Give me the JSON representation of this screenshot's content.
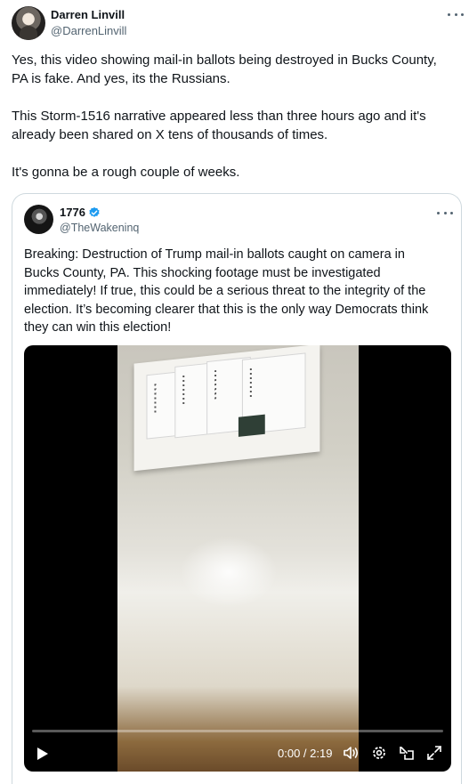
{
  "tweet": {
    "author": {
      "name": "Darren Linvill",
      "handle": "@DarrenLinvill"
    },
    "paragraphs": [
      "Yes, this video showing mail-in ballots being destroyed in Bucks County,\nPA is fake. And yes, its the Russians.",
      "This Storm-1516 narrative appeared less than three hours ago and it's\nalready been shared on X tens of thousands of times.",
      "It's gonna be a rough couple of weeks."
    ]
  },
  "quote": {
    "author": {
      "name": "1776",
      "handle": "@TheWakeninq",
      "verified": true
    },
    "text": "Breaking: Destruction of Trump mail-in ballots caught on camera in\nBucks County, PA. This shocking footage must be investigated\nimmediately! If true, this could be a serious threat to the integrity of the\nelection. It’s becoming clearer that this is the only way Democrats think\nthey can win this election!",
    "video": {
      "time_display": "0:00 / 2:19",
      "progress_fraction": 0.0
    }
  },
  "icons": {
    "more": "more-horizontal-icon",
    "verified": "verified-badge-icon",
    "play": "play-icon",
    "volume": "volume-icon",
    "settings": "settings-gear-icon",
    "pip": "picture-in-picture-icon",
    "fullscreen": "fullscreen-icon"
  },
  "colors": {
    "text": "#0f1419",
    "secondary_text": "#536471",
    "verified_blue": "#1d9bf0",
    "card_border": "#cfd9de",
    "video_bg": "#000000"
  }
}
